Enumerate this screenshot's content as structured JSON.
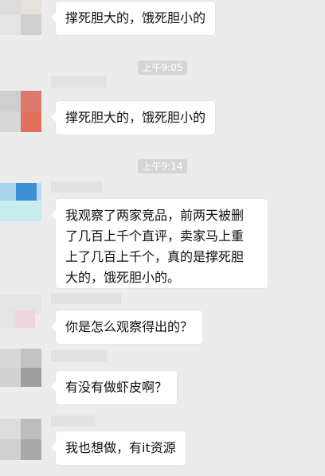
{
  "timestamps": [
    "上午9:05",
    "上午9:14"
  ],
  "messages": [
    {
      "text": "撑死胆大的，饿死胆小的"
    },
    {
      "text": "撑死胆大的，饿死胆小的"
    },
    {
      "text": "我观察了两家竞品，前两天被删\n了几百上千个直评，卖家马上重\n上了几百上千个，真的是撑死胆\n大的，饿死胆小的。"
    },
    {
      "text": "你是怎么观察得出的？"
    },
    {
      "text": "有没有做虾皮啊？"
    },
    {
      "text": "我也想做，有it资源"
    }
  ],
  "colors": {
    "background": "#ececec",
    "bubble": "#ffffff",
    "timestamp_badge": "#d5d5d5",
    "text": "#111111"
  }
}
